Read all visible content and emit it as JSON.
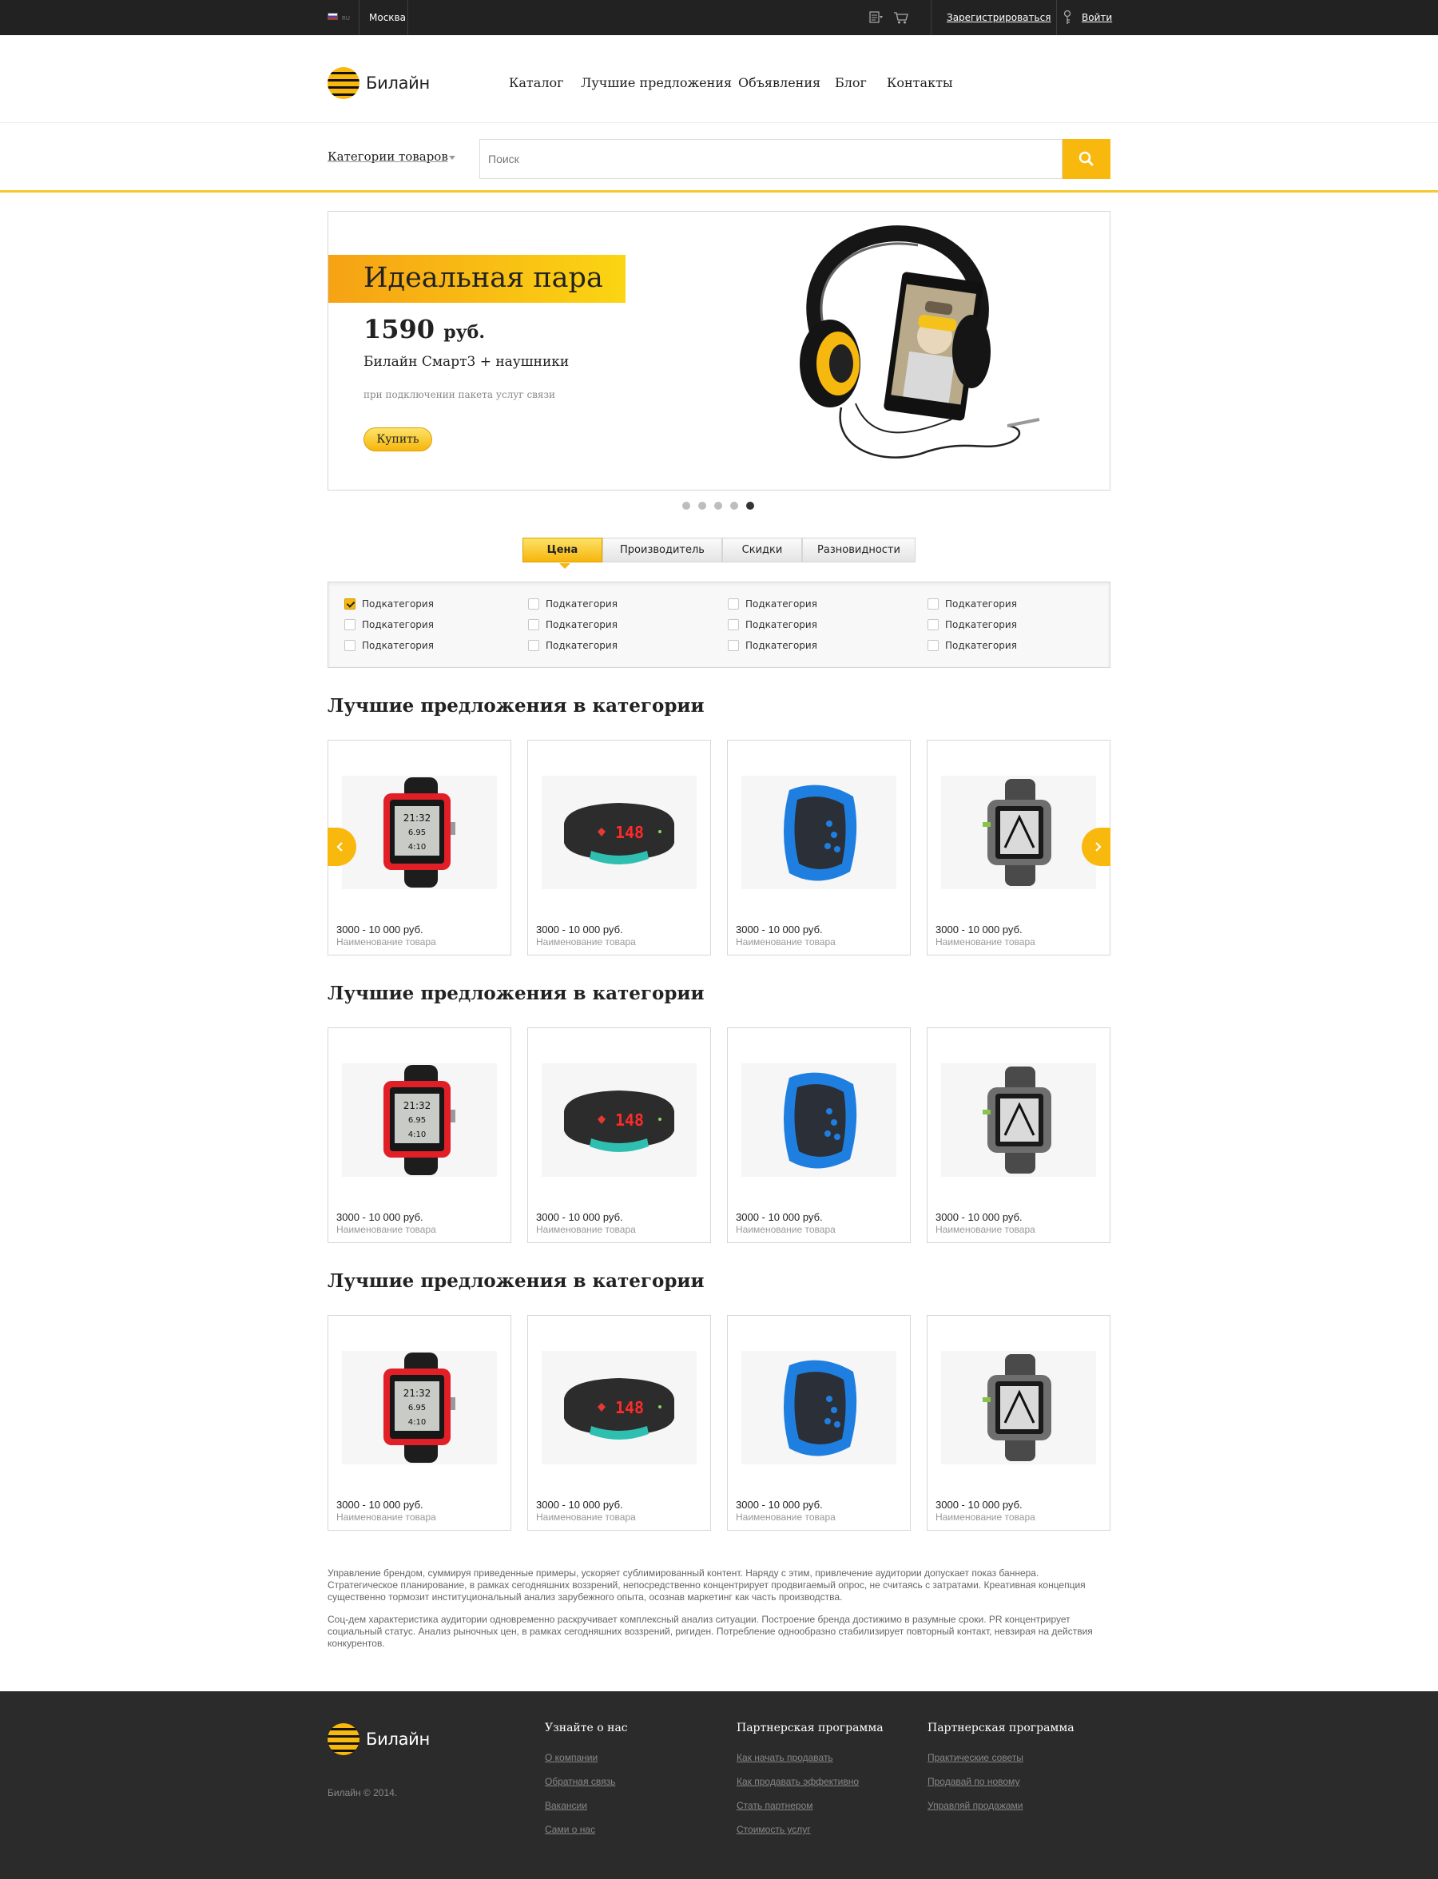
{
  "topbar": {
    "lang": "RU",
    "city": "Москва",
    "register_label": "Зарегистрироваться",
    "login_label": "Войти"
  },
  "brand": {
    "name": "Билайн"
  },
  "nav": {
    "items": [
      {
        "label": "Каталог"
      },
      {
        "label": "Лучшие предложения"
      },
      {
        "label": "Объявления"
      },
      {
        "label": "Блог"
      },
      {
        "label": "Контакты"
      }
    ]
  },
  "search": {
    "categories_label": "Категории товаров",
    "placeholder": "Поиск"
  },
  "banner": {
    "headline": "Идеальная пара",
    "price": "1590",
    "currency": "руб.",
    "model": "Билайн Смарт3 + наушники",
    "condition": "при подключении пакета услуг связи",
    "buy_label": "Купить",
    "slides_total": 5,
    "active_slide": 5
  },
  "filters": {
    "tabs": [
      {
        "label": "Цена",
        "active": true
      },
      {
        "label": "Производитель",
        "active": false
      },
      {
        "label": "Скидки",
        "active": false
      },
      {
        "label": "Разновидности",
        "active": false
      }
    ],
    "checkboxes": [
      [
        "Подкатегория",
        "Подкатегория",
        "Подкатегория",
        "Подкатегория"
      ],
      [
        "Подкатегория",
        "Подкатегория",
        "Подкатегория",
        "Подкатегория"
      ],
      [
        "Подкатегория",
        "Подкатегория",
        "Подкатегория",
        "Подкатегория"
      ]
    ],
    "checked": [
      [
        true,
        false,
        false,
        false
      ],
      [
        false,
        false,
        false,
        false
      ],
      [
        false,
        false,
        false,
        false
      ]
    ]
  },
  "sections": [
    {
      "title": "Лучшие предложения в категории",
      "products": [
        {
          "price": "3000 - 10 000 руб.",
          "name": "Наименование товара",
          "image": "red-smartwatch"
        },
        {
          "price": "3000 - 10 000 руб.",
          "name": "Наименование товара",
          "image": "black-fitness-band"
        },
        {
          "price": "3000 - 10 000 руб.",
          "name": "Наименование товара",
          "image": "blue-armband"
        },
        {
          "price": "3000 - 10 000 руб.",
          "name": "Наименование товара",
          "image": "grey-gps-watch"
        }
      ]
    },
    {
      "title": "Лучшие предложения в категории",
      "products": [
        {
          "price": "3000 - 10 000 руб.",
          "name": "Наименование товара",
          "image": "red-smartwatch"
        },
        {
          "price": "3000 - 10 000 руб.",
          "name": "Наименование товара",
          "image": "black-fitness-band"
        },
        {
          "price": "3000 - 10 000 руб.",
          "name": "Наименование товара",
          "image": "blue-armband"
        },
        {
          "price": "3000 - 10 000 руб.",
          "name": "Наименование товара",
          "image": "grey-gps-watch"
        }
      ]
    },
    {
      "title": "Лучшие предложения в категории",
      "products": [
        {
          "price": "3000 - 10 000 руб.",
          "name": "Наименование товара",
          "image": "red-smartwatch"
        },
        {
          "price": "3000 - 10 000 руб.",
          "name": "Наименование товара",
          "image": "black-fitness-band"
        },
        {
          "price": "3000 - 10 000 руб.",
          "name": "Наименование товара",
          "image": "blue-armband"
        },
        {
          "price": "3000 - 10 000 руб.",
          "name": "Наименование товара",
          "image": "grey-gps-watch"
        }
      ]
    }
  ],
  "product_screen": {
    "watch_time": "21:32",
    "watch_line2": "6.95",
    "watch_line3": "4:10",
    "band_display": "148"
  },
  "seo_text": {
    "p1": "Управление брендом, суммируя приведенные примеры, ускоряет сублимированный контент. Наряду с этим, привлечение аудитории допускает показ баннера. Стратегическое планирование, в рамках сегодняшних воззрений, непосредственно концентрирует продвигаемый опрос, не считаясь с затратами. Креативная концепция существенно тормозит институциональный анализ зарубежного опыта, осознав маркетинг как часть производства.",
    "p2": "Соц-дем характеристика аудитории одновременно раскручивает комплексный анализ ситуации. Построение бренда достижимо в разумные сроки. PR концентрирует социальный статус. Анализ рыночных цен, в рамках сегодняшних воззрений, ригиден. Потребление однообразно стабилизирует повторный контакт, невзирая на действия конкурентов."
  },
  "footer": {
    "copyright": "Билайн © 2014.",
    "columns": [
      {
        "title": "Узнайте о нас",
        "links": [
          "О компании",
          "Обратная связь",
          "Вакансии",
          "Сами о нас"
        ]
      },
      {
        "title": "Партнерская программа",
        "links": [
          "Как начать продавать",
          "Как продавать эффективно",
          "Стать партнером",
          "Стоимость услуг"
        ]
      },
      {
        "title": "Партнерская программа",
        "links": [
          "Практические советы",
          "Продавай по новому",
          "Управляй продажами"
        ]
      }
    ]
  },
  "icons": {
    "search": "search-icon",
    "cart": "cart-icon",
    "compare": "compare-list-icon",
    "key": "key-icon",
    "arrow_left": "chevron-left-icon",
    "arrow_right": "chevron-right-icon"
  },
  "colors": {
    "accent": "#f8b80d",
    "topbar": "#222222",
    "footer": "#2b2b2b"
  }
}
